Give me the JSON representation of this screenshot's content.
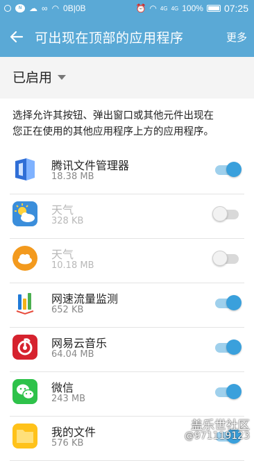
{
  "status_bar": {
    "net_speed": "0B|0B",
    "battery": "100%",
    "time": "07:25",
    "signal1": "4G",
    "signal2": "4G"
  },
  "app_bar": {
    "title": "可出现在顶部的应用程序",
    "more": "更多"
  },
  "filter": {
    "label": "已启用"
  },
  "description": {
    "line1": "选择允许其按钮、弹出窗口或其他元件出现在",
    "line2": "您正在使用的其他应用程序上方的应用程序。"
  },
  "apps": [
    {
      "name": "腾讯文件管理器",
      "size": "18.38 MB",
      "enabled": true,
      "icon": "tencent-file-manager-icon"
    },
    {
      "name": "天气",
      "size": "328 KB",
      "enabled": false,
      "icon": "weather-icon"
    },
    {
      "name": "天气",
      "size": "10.18 MB",
      "enabled": false,
      "icon": "weather-cloud-icon"
    },
    {
      "name": "网速流量监测",
      "size": "652 KB",
      "enabled": true,
      "icon": "network-monitor-icon"
    },
    {
      "name": "网易云音乐",
      "size": "64.04 MB",
      "enabled": true,
      "icon": "netease-music-icon"
    },
    {
      "name": "微信",
      "size": "243 MB",
      "enabled": true,
      "icon": "wechat-icon"
    },
    {
      "name": "我的文件",
      "size": "576 KB",
      "enabled": true,
      "icon": "my-files-icon"
    }
  ],
  "watermark": {
    "line1": "盖乐世社区",
    "line2": "@971119123"
  },
  "colors": {
    "accent": "#5aa9d6",
    "toggle_on": "#3aa0dc"
  }
}
